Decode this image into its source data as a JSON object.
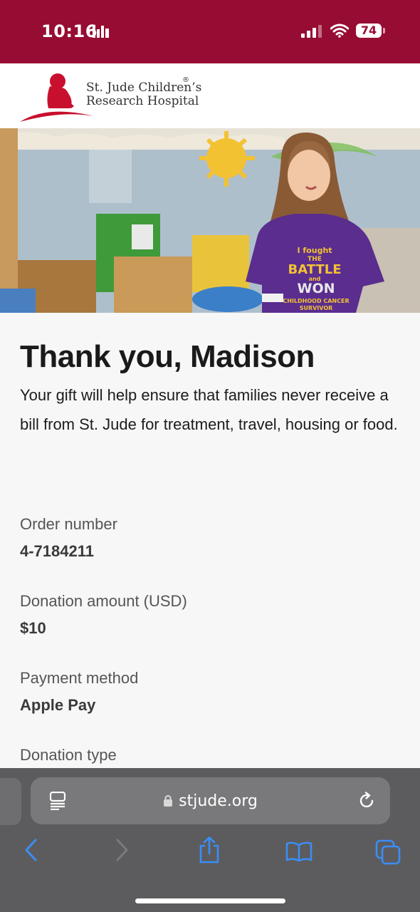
{
  "status_bar": {
    "time": "10:16",
    "battery": "74",
    "background": "#970c33"
  },
  "header": {
    "logo_line1": "St. Jude Children’s",
    "logo_line2": "Research Hospital",
    "logo_registered": "®",
    "brand_color": "#c8102e"
  },
  "hero": {
    "shirt_lines": [
      "I fought",
      "THE",
      "BATTLE",
      "and",
      "WON",
      "CHILDHOOD CANCER",
      "SURVIVOR"
    ]
  },
  "confirmation": {
    "title": "Thank you, Madison",
    "body": "Your gift will help ensure that families never receive a bill from St. Jude for treatment, travel, housing or food."
  },
  "details": [
    {
      "label": "Order number",
      "value": "4-7184211"
    },
    {
      "label": "Donation amount (USD)",
      "value": "$10"
    },
    {
      "label": "Payment method",
      "value": "Apple Pay"
    },
    {
      "label": "Donation type",
      "value": ""
    }
  ],
  "browser": {
    "url": "stjude.org",
    "toolbar": [
      "back-icon",
      "forward-icon",
      "share-icon",
      "bookmarks-icon",
      "tabs-icon"
    ],
    "accent": "#3a8ef6"
  }
}
